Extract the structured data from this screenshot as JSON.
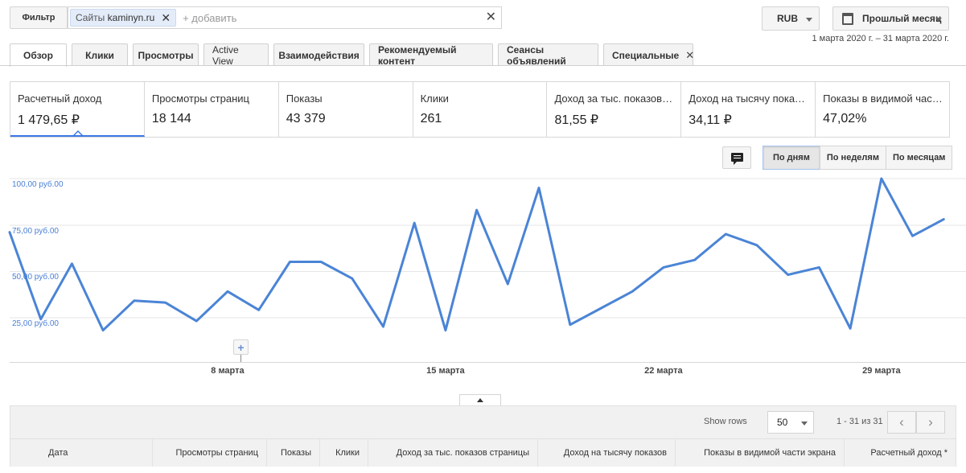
{
  "filter": {
    "button_label": "Фильтр",
    "chip_label": "Сайты",
    "chip_value": "kaminyn.ru",
    "add_placeholder": "+ добавить"
  },
  "currency": {
    "label": "RUB"
  },
  "period": {
    "label": "Прошлый месяц",
    "range": "1 марта 2020 г. – 31 марта 2020 г."
  },
  "tabs": [
    {
      "label": "Обзор"
    },
    {
      "label": "Клики"
    },
    {
      "label": "Просмотры"
    },
    {
      "label": "Active View"
    },
    {
      "label": "Взаимодействия"
    },
    {
      "label": "Рекомендуемый контент"
    },
    {
      "label": "Сеансы объявлений"
    },
    {
      "label": "Специальные"
    }
  ],
  "metrics": [
    {
      "label": "Расчетный доход",
      "value": "1 479,65 ₽"
    },
    {
      "label": "Просмотры страниц",
      "value": "18 144"
    },
    {
      "label": "Показы",
      "value": "43 379"
    },
    {
      "label": "Клики",
      "value": "261"
    },
    {
      "label": "Доход за тыс. показов страницы",
      "value": "81,55 ₽"
    },
    {
      "label": "Доход на тысячу показов",
      "value": "34,11 ₽"
    },
    {
      "label": "Показы в видимой части экрана",
      "value": "47,02%"
    }
  ],
  "granularity": [
    {
      "label": "По дням"
    },
    {
      "label": "По неделям"
    },
    {
      "label": "По месяцам"
    }
  ],
  "colors": {
    "line": "#4a84d6",
    "accent": "#3b78e7",
    "axis_label": "#4a7fd4"
  },
  "chart_data": {
    "type": "line",
    "y_tick_labels": [
      "100,00 руб.00",
      "75,00 руб.00",
      "50,00 руб.00",
      "25,00 руб.00"
    ],
    "y_ticks": [
      100,
      75,
      50,
      25
    ],
    "ylim": [
      0,
      110
    ],
    "x_tick_labels": [
      {
        "day": 8,
        "label": "8 марта"
      },
      {
        "day": 15,
        "label": "15 марта"
      },
      {
        "day": 22,
        "label": "22 марта"
      },
      {
        "day": 29,
        "label": "29 марта"
      }
    ],
    "x": [
      1,
      2,
      3,
      4,
      5,
      6,
      7,
      8,
      9,
      10,
      11,
      12,
      13,
      14,
      15,
      16,
      17,
      18,
      19,
      20,
      21,
      22,
      23,
      24,
      25,
      26,
      27,
      28,
      29,
      30,
      31
    ],
    "values": [
      71,
      24,
      54,
      18,
      34,
      33,
      23,
      39,
      29,
      55,
      55,
      46,
      20,
      76,
      18,
      83,
      43,
      95,
      21,
      30,
      39,
      52,
      56,
      70,
      64,
      48,
      52,
      19,
      100,
      69,
      78
    ],
    "xlim": [
      1,
      31.2
    ],
    "grid": true,
    "legend": "none"
  },
  "table": {
    "show_rows_label": "Show rows",
    "rows_value": "50",
    "page_info": "1 - 31 из 31",
    "prev_icon": "‹",
    "next_icon": "›",
    "columns": [
      "Дата",
      "Просмотры страниц",
      "Показы",
      "Клики",
      "Доход за тыс. показов страницы",
      "Доход на тысячу показов",
      "Показы в видимой части экрана",
      "Расчетный доход *"
    ]
  }
}
